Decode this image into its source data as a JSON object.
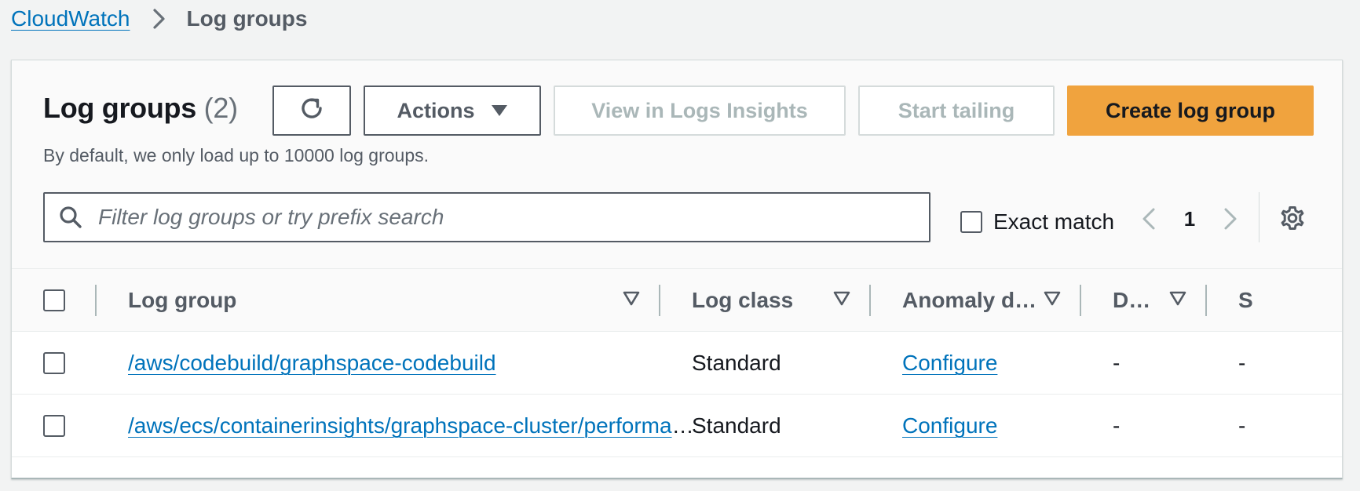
{
  "breadcrumb": {
    "root": "CloudWatch",
    "current": "Log groups"
  },
  "panel": {
    "title": "Log groups",
    "count": "(2)",
    "subtitle": "By default, we only load up to 10000 log groups."
  },
  "toolbar": {
    "refresh_icon": "refresh-icon",
    "actions_label": "Actions",
    "insights_label": "View in Logs Insights",
    "tailing_label": "Start tailing",
    "create_label": "Create log group",
    "primary_color": "#f0a33e"
  },
  "search": {
    "placeholder": "Filter log groups or try prefix search",
    "value": ""
  },
  "exact_match": {
    "label": "Exact match",
    "checked": false
  },
  "pagination": {
    "page": "1"
  },
  "table": {
    "columns": [
      "Log group",
      "Log class",
      "Anomaly d…",
      "D…",
      "S"
    ],
    "rows": [
      {
        "name": "/aws/codebuild/graphspace-codebuild",
        "log_class": "Standard",
        "anomaly": "Configure",
        "data_protection": "-",
        "extra": "-"
      },
      {
        "name": "/aws/ecs/containerinsights/graphspace-cluster/performance",
        "log_class": "Standard",
        "anomaly": "Configure",
        "data_protection": "-",
        "extra": "-"
      }
    ]
  }
}
